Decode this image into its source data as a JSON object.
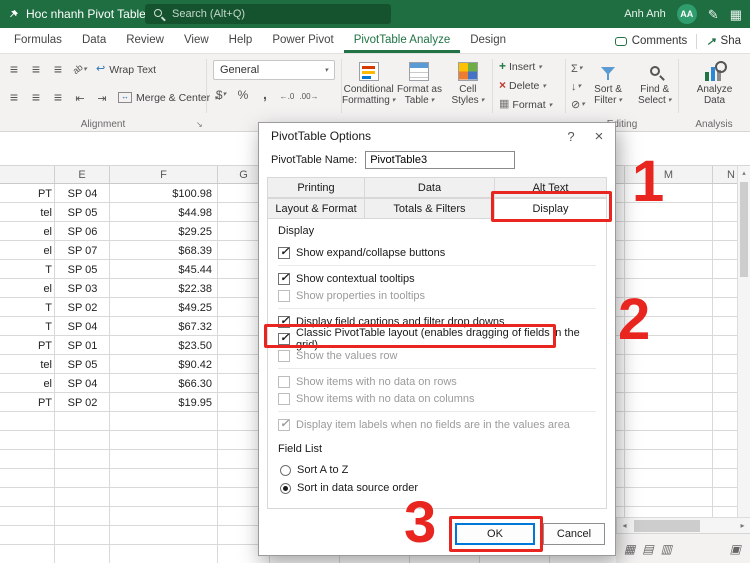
{
  "titlebar": {
    "doc_title": "Hoc nhanh Pivot Table",
    "search_placeholder": "Search (Alt+Q)",
    "user_name": "Anh Anh",
    "avatar_initials": "AA"
  },
  "ribbon": {
    "tabs": [
      "Formulas",
      "Data",
      "Review",
      "View",
      "Help",
      "Power Pivot",
      "PivotTable Analyze",
      "Design"
    ],
    "active_tab": "PivotTable Analyze",
    "comments_label": "Comments",
    "share_label": "Sha",
    "alignment": {
      "wrap_text": "Wrap Text",
      "merge_center": "Merge & Center",
      "group_label": "Alignment"
    },
    "number": {
      "format_value": "General"
    },
    "styles": [
      {
        "line1": "Conditional",
        "line2": "Formatting"
      },
      {
        "line1": "Format as",
        "line2": "Table"
      },
      {
        "line1": "Cell",
        "line2": "Styles"
      }
    ],
    "cells": [
      "Insert",
      "Delete",
      "Format"
    ],
    "editing": {
      "buttons": [
        {
          "line1": "Sort &",
          "line2": "Filter"
        },
        {
          "line1": "Find &",
          "line2": "Select"
        }
      ],
      "group_label": "Editing"
    },
    "analysis": {
      "button": {
        "line1": "Analyze",
        "line2": "Data"
      },
      "group_label": "Analysis"
    }
  },
  "sheet": {
    "col_headers": [
      "E",
      "F",
      "G",
      "M",
      "N"
    ],
    "rows": [
      {
        "d": "PT",
        "e": "SP 04",
        "f": "$100.98"
      },
      {
        "d": "tel",
        "e": "SP 05",
        "f": "$44.98"
      },
      {
        "d": "el",
        "e": "SP 06",
        "f": "$29.25"
      },
      {
        "d": "el",
        "e": "SP 07",
        "f": "$68.39"
      },
      {
        "d": "T",
        "e": "SP 05",
        "f": "$45.44"
      },
      {
        "d": "el",
        "e": "SP 03",
        "f": "$22.38"
      },
      {
        "d": "T",
        "e": "SP 02",
        "f": "$49.25"
      },
      {
        "d": "T",
        "e": "SP 04",
        "f": "$67.32"
      },
      {
        "d": "PT",
        "e": "SP 01",
        "f": "$23.50"
      },
      {
        "d": "tel",
        "e": "SP 05",
        "f": "$90.42"
      },
      {
        "d": "el",
        "e": "SP 04",
        "f": "$66.30"
      },
      {
        "d": "PT",
        "e": "SP 02",
        "f": "$19.95"
      }
    ]
  },
  "dialog": {
    "title": "PivotTable Options",
    "name_label": "PivotTable Name:",
    "name_value": "PivotTable3",
    "tabs_top": [
      "Printing",
      "Data",
      "Alt Text"
    ],
    "tabs_bottom": [
      "Layout & Format",
      "Totals & Filters",
      "Display"
    ],
    "active_tab": "Display",
    "display_section_label": "Display",
    "options": [
      {
        "label": "Show expand/collapse buttons",
        "checked": true,
        "disabled": false
      },
      {
        "label": "Show contextual tooltips",
        "checked": true,
        "disabled": false
      },
      {
        "label": "Show properties in tooltips",
        "checked": false,
        "disabled": true
      },
      {
        "label": "Display field captions and filter drop downs",
        "checked": true,
        "disabled": false
      },
      {
        "label": "Classic PivotTable layout (enables dragging of fields in the grid)",
        "checked": true,
        "disabled": false
      },
      {
        "label": "Show the values row",
        "checked": false,
        "disabled": true
      },
      {
        "label": "Show items with no data on rows",
        "checked": false,
        "disabled": true
      },
      {
        "label": "Show items with no data on columns",
        "checked": false,
        "disabled": true
      },
      {
        "label": "Display item labels when no fields are in the values area",
        "checked": true,
        "disabled": true
      }
    ],
    "field_list_section_label": "Field List",
    "radios": [
      {
        "label": "Sort A to Z",
        "selected": false
      },
      {
        "label": "Sort in data source order",
        "selected": true
      }
    ],
    "ok_label": "OK",
    "cancel_label": "Cancel"
  },
  "annotations": {
    "step1": "1",
    "step2": "2",
    "step3": "3",
    "accent_color": "#e8251f"
  }
}
